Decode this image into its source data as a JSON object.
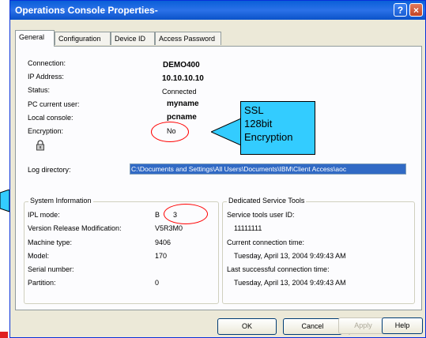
{
  "window": {
    "title": "Operations Console Properties-",
    "help_glyph": "?",
    "close_glyph": "×"
  },
  "tabs": [
    "General",
    "Configuration",
    "Device ID",
    "Access Password"
  ],
  "fields": [
    {
      "label": "Connection:",
      "value": "DEMO400"
    },
    {
      "label": "IP Address:",
      "value": "10.10.10.10"
    },
    {
      "label": "Status:",
      "value": "Connected"
    },
    {
      "label": "PC current user:",
      "value": "myname"
    },
    {
      "label": "Local console:",
      "value": "pcname"
    },
    {
      "label": "Encryption:",
      "value": "No"
    }
  ],
  "log_directory": {
    "label": "Log directory:",
    "value": "C:\\Documents and Settings\\All Users\\Documents\\IBM\\Client Access\\aoc"
  },
  "system_info": {
    "title": "System Information",
    "ipl_mode_label": "IPL mode:",
    "ipl_mode_value": "B",
    "ipl_mode_extra": "3",
    "vrm_label": "Version Release Modification:",
    "vrm_value": "V5R3M0",
    "machine_label": "Machine type:",
    "machine_value": "9406",
    "model_label": "Model:",
    "model_value": "170",
    "serial_label": "Serial number:",
    "partition_label": "Partition:",
    "partition_value": "0"
  },
  "dst": {
    "title": "Dedicated Service Tools",
    "user_label": "Service tools user ID:",
    "user_value": "11111111",
    "current_label": "Current connection time:",
    "current_value": "Tuesday, April 13, 2004 9:49:43 AM",
    "last_label": "Last successful connection time:",
    "last_value": "Tuesday, April 13, 2004 9:49:43 AM"
  },
  "buttons": {
    "ok": "OK",
    "cancel": "Cancel",
    "apply": "Apply",
    "help": "Help"
  },
  "callout": {
    "line1": "SSL",
    "line2": "128bit",
    "line3": "Encryption"
  },
  "colors": {
    "callout_fill": "#33ccff",
    "highlight_ellipse": "#ff0000",
    "title_bar": "#0a5fd8"
  }
}
